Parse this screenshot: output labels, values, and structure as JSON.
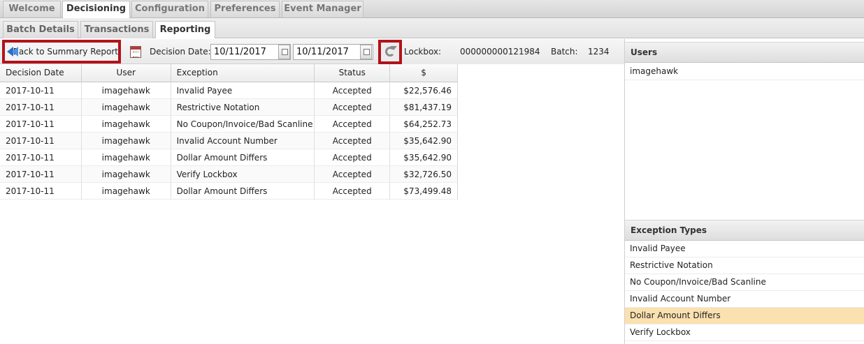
{
  "top_tabs": [
    "Welcome",
    "Decisioning",
    "Configuration",
    "Preferences",
    "Event Manager"
  ],
  "active_top_tab": "Decisioning",
  "sub_tabs": [
    "Batch Details",
    "Transactions",
    "Reporting"
  ],
  "active_sub_tab": "Reporting",
  "toolbar": {
    "back_label": "Back to Summary Report",
    "decision_date_label": "Decision Date:",
    "date_from": "10/11/2017",
    "date_to": "10/11/2017",
    "lockbox_label": "Lockbox:",
    "lockbox_value": "000000000121984",
    "batch_label": "Batch:",
    "batch_value": "1234"
  },
  "grid": {
    "columns": [
      "Decision Date",
      "User",
      "Exception",
      "Status",
      "$"
    ],
    "rows": [
      [
        "2017-10-11",
        "imagehawk",
        "Invalid Payee",
        "Accepted",
        "$22,576.46"
      ],
      [
        "2017-10-11",
        "imagehawk",
        "Restrictive Notation",
        "Accepted",
        "$81,437.19"
      ],
      [
        "2017-10-11",
        "imagehawk",
        "No Coupon/Invoice/Bad Scanline",
        "Accepted",
        "$64,252.73"
      ],
      [
        "2017-10-11",
        "imagehawk",
        "Invalid Account Number",
        "Accepted",
        "$35,642.90"
      ],
      [
        "2017-10-11",
        "imagehawk",
        "Dollar Amount Differs",
        "Accepted",
        "$35,642.90"
      ],
      [
        "2017-10-11",
        "imagehawk",
        "Verify Lockbox",
        "Accepted",
        "$32,726.50"
      ],
      [
        "2017-10-11",
        "imagehawk",
        "Dollar Amount Differs",
        "Accepted",
        "$73,499.48"
      ]
    ]
  },
  "users_panel": {
    "title": "Users",
    "items": [
      "imagehawk"
    ]
  },
  "exceptions_panel": {
    "title": "Exception Types",
    "items": [
      "Invalid Payee",
      "Restrictive Notation",
      "No Coupon/Invoice/Bad Scanline",
      "Invalid Account Number",
      "Dollar Amount Differs",
      "Verify Lockbox"
    ],
    "selected": "Dollar Amount Differs"
  },
  "colors": {
    "highlight_border": "#b3121b",
    "selected_row": "#fbe1b0"
  }
}
